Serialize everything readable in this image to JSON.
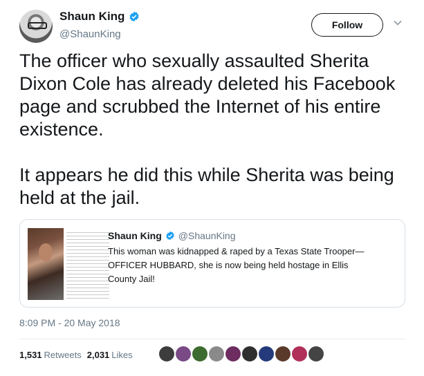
{
  "author": {
    "display_name": "Shaun King",
    "handle": "@ShaunKing",
    "verified": true
  },
  "follow_button": {
    "label": "Follow"
  },
  "icons": {
    "verified": "verified-badge-icon",
    "menu": "chevron-down-icon"
  },
  "colors": {
    "verified": "#1da1f2",
    "text": "#14171a",
    "secondary": "#657786",
    "border": "#d6dfe6"
  },
  "tweet": {
    "paragraphs": [
      "The officer who sexually assaulted Sherita\nDixon Cole has already deleted his Facebook\npage and scrubbed the Internet of his entire\nexistence.",
      "It appears he did this while Sherita was being\nheld at the jail."
    ]
  },
  "quoted_tweet": {
    "display_name": "Shaun King",
    "handle": "@ShaunKing",
    "verified": true,
    "text": "This woman was kidnapped & raped by a Texas State Trooper—\nOFFICER HUBBARD, she is now being held hostage in Ellis\nCounty Jail!"
  },
  "timestamp": "8:09 PM - 20 May 2018",
  "stats": {
    "retweets": "1,531",
    "retweets_label": "Retweets",
    "likes": "2,031",
    "likes_label": "Likes"
  },
  "likers": [
    {
      "color": "#3d3d3d"
    },
    {
      "color": "#7a4a86"
    },
    {
      "color": "#3e6b2f"
    },
    {
      "color": "#8a8a8a"
    },
    {
      "color": "#6d2d60"
    },
    {
      "color": "#2f2f2f"
    },
    {
      "color": "#243a7a"
    },
    {
      "color": "#5a3a2a"
    },
    {
      "color": "#b0305a"
    },
    {
      "color": "#444444"
    }
  ]
}
